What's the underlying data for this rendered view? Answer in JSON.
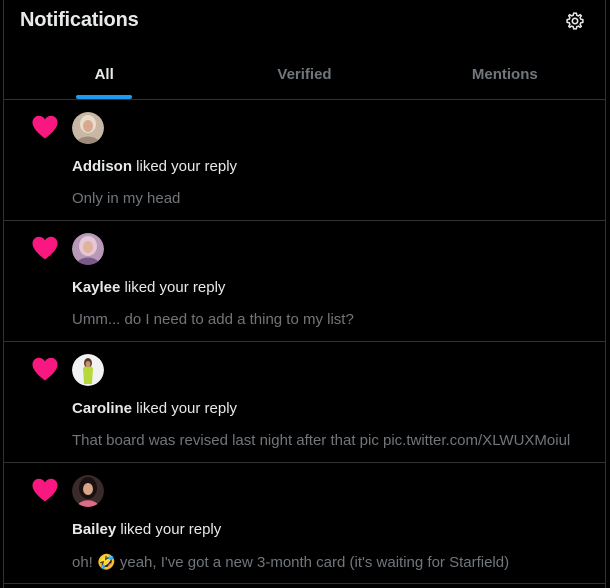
{
  "header": {
    "title": "Notifications",
    "settings_icon": "gear-icon"
  },
  "tabs": [
    {
      "label": "All",
      "active": true
    },
    {
      "label": "Verified",
      "active": false
    },
    {
      "label": "Mentions",
      "active": false
    }
  ],
  "colors": {
    "accent": "#1d9bf0",
    "like": "#f91880",
    "muted_text": "#71767b",
    "primary_text": "#e7e9ea",
    "divider": "#2f3336"
  },
  "notifications": [
    {
      "icon": "heart-icon",
      "user": "Addison",
      "action": " liked your reply",
      "preview": "Only in my head"
    },
    {
      "icon": "heart-icon",
      "user": "Kaylee",
      "action": " liked your reply",
      "preview": "Umm... do I need to add a thing to my list?"
    },
    {
      "icon": "heart-icon",
      "user": "Caroline",
      "action": " liked your reply",
      "preview": "That board was revised last night after that pic pic.twitter.com/XLWUXMoiul"
    },
    {
      "icon": "heart-icon",
      "user": "Bailey",
      "action": " liked your reply",
      "preview": "oh! 🤣 yeah, I've got a new 3-month card (it's waiting for Starfield)"
    }
  ]
}
